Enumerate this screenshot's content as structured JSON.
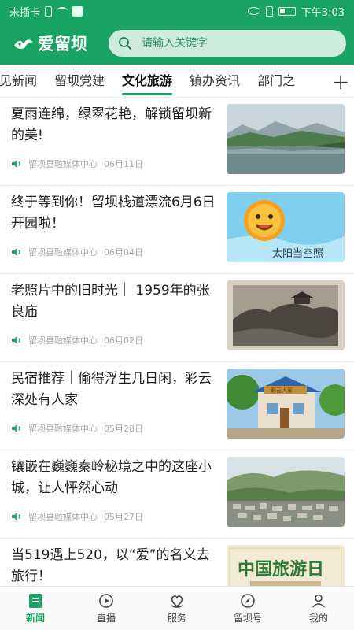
{
  "status_bar": {
    "carrier": "未插卡",
    "time": "下午3:03"
  },
  "header": {
    "logo_text": "爱留坝",
    "search_placeholder": "请输入关键字"
  },
  "tabs": [
    {
      "label": "见新闻",
      "active": false
    },
    {
      "label": "留坝党建",
      "active": false
    },
    {
      "label": "文化旅游",
      "active": true
    },
    {
      "label": "镇办资讯",
      "active": false
    },
    {
      "label": "部门之",
      "active": false
    }
  ],
  "add_tab_symbol": "+",
  "news": [
    {
      "title": "夏雨连绵，绿翠花艳，解锁留坝新的美!",
      "source": "留坝县融媒体中心",
      "date": "06月11日",
      "thumb": "lake-mountains"
    },
    {
      "title": "终于等到你！留坝栈道漂流6月6日开园啦！",
      "source": "留坝县融媒体中心",
      "date": "06月04日",
      "thumb": "sun-cartoon",
      "thumb_caption": "太阳当空照"
    },
    {
      "title": "老照片中的旧时光｜ 1959年的张良庙",
      "source": "留坝县融媒体中心",
      "date": "06月02日",
      "thumb": "old-photo"
    },
    {
      "title": "民宿推荐｜偷得浮生几日闲，彩云深处有人家",
      "source": "留坝县融媒体中心",
      "date": "05月28日",
      "thumb": "guesthouse",
      "thumb_caption": "彩云人家"
    },
    {
      "title": "镶嵌在巍巍秦岭秘境之中的这座小城，让人怦然心动",
      "source": "留坝县融媒体中心",
      "date": "05月27日",
      "thumb": "town-valley"
    },
    {
      "title": "当519遇上520，以“爱”的名义去旅行！",
      "source": "",
      "date": "",
      "thumb": "travel-day",
      "thumb_caption": "中国旅游日"
    }
  ],
  "bottom_nav": [
    {
      "label": "新闻",
      "icon": "news-icon",
      "active": true
    },
    {
      "label": "直播",
      "icon": "live-icon",
      "active": false
    },
    {
      "label": "服务",
      "icon": "service-icon",
      "active": false
    },
    {
      "label": "留坝号",
      "icon": "compass-icon",
      "active": false
    },
    {
      "label": "我的",
      "icon": "profile-icon",
      "active": false
    }
  ],
  "colors": {
    "brand": "#1aa463",
    "text": "#222222",
    "meta": "#aaaaaa"
  }
}
